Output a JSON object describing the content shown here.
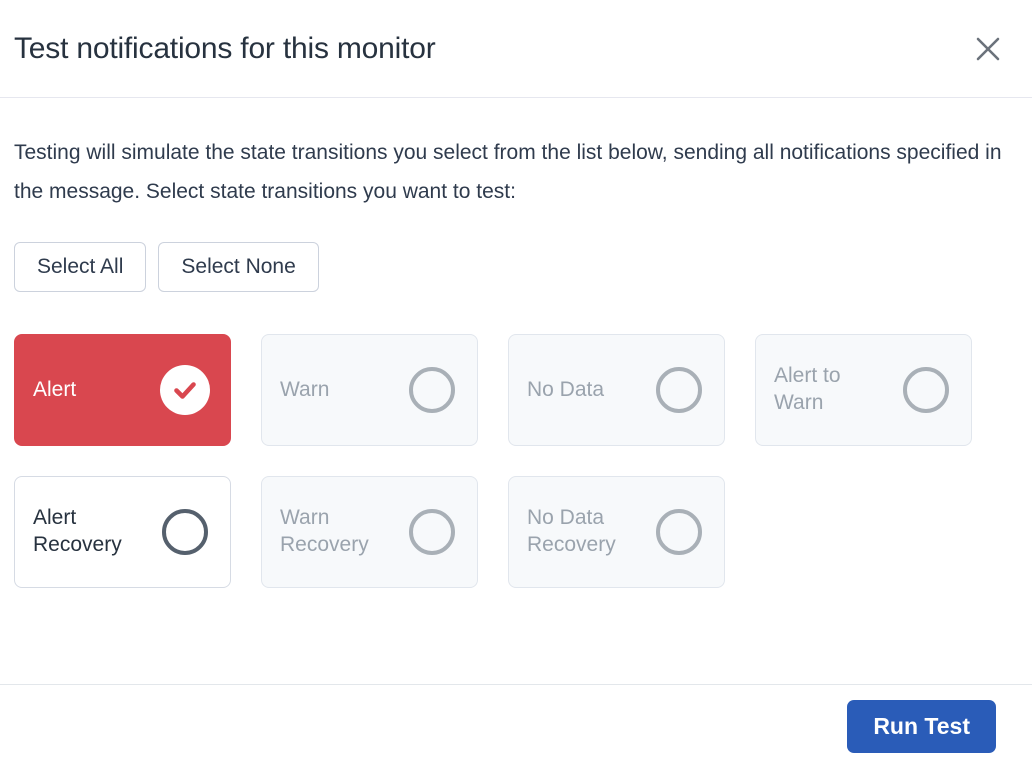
{
  "header": {
    "title": "Test notifications for this monitor",
    "close_icon": "close-icon"
  },
  "body": {
    "description": "Testing will simulate the state transitions you select from the list below, sending all notifications specified in the message. Select state transitions you want to test:",
    "select_all_label": "Select All",
    "select_none_label": "Select None"
  },
  "transitions": [
    {
      "label": "Alert",
      "state": "selected",
      "indicator": "check-circle-icon"
    },
    {
      "label": "Warn",
      "state": "disabled",
      "indicator": "empty-circle-icon"
    },
    {
      "label": "No Data",
      "state": "disabled",
      "indicator": "empty-circle-icon"
    },
    {
      "label": "Alert to Warn",
      "state": "disabled",
      "indicator": "empty-circle-icon"
    },
    {
      "label": "Alert Recovery",
      "state": "unselected",
      "indicator": "empty-circle-icon"
    },
    {
      "label": "Warn Recovery",
      "state": "disabled",
      "indicator": "empty-circle-icon"
    },
    {
      "label": "No Data Recovery",
      "state": "disabled",
      "indicator": "empty-circle-icon"
    }
  ],
  "footer": {
    "run_test_label": "Run Test"
  },
  "colors": {
    "selected_red": "#d9474f",
    "primary_blue": "#2a5cb8",
    "text_dark": "#27323f",
    "text_muted": "#9aa3ad",
    "border": "#d6dbe4",
    "disabled_bg": "#f7f9fb"
  }
}
